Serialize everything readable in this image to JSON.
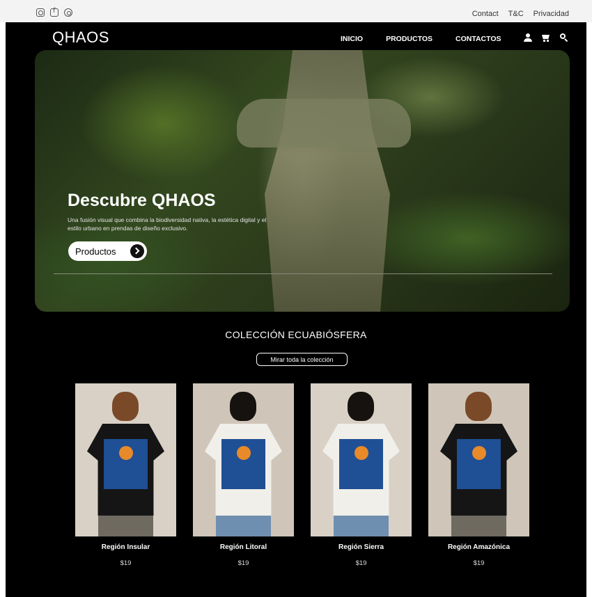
{
  "topbar": {
    "social_icons": [
      "instagram-icon",
      "facebook-icon",
      "whatsapp-icon"
    ],
    "links": [
      "Contact",
      "T&C",
      "Privacidad"
    ]
  },
  "header": {
    "logo": "QHAOS",
    "nav": [
      "INICIO",
      "PRODUCTOS",
      "CONTACTOS"
    ],
    "icons": [
      "user-icon",
      "cart-icon",
      "search-icon"
    ]
  },
  "hero": {
    "title": "Descubre QHAOS",
    "subtitle": "Una fusión visual que combina la biodiversidad nativa, la estética digital y el estilo urbano en prendas de diseño exclusivo.",
    "button_label": "Productos"
  },
  "collection": {
    "title": "COLECCIÓN ECUABIÓSFERA",
    "button_label": "Mirar toda la colección",
    "products": [
      {
        "name": "Región Insular",
        "price": "$19",
        "shirt_color": "#151515",
        "hair_color": "#7a4a28",
        "pants_color": "#6f6a60"
      },
      {
        "name": "Región Litoral",
        "price": "$19",
        "shirt_color": "#f1efe9",
        "hair_color": "#15120f",
        "pants_color": "#6f8fb0"
      },
      {
        "name": "Región Sierra",
        "price": "$19",
        "shirt_color": "#f1efe9",
        "hair_color": "#15120f",
        "pants_color": "#6f8fb0"
      },
      {
        "name": "Región Amazónica",
        "price": "$19",
        "shirt_color": "#151515",
        "hair_color": "#7a4a28",
        "pants_color": "#6f6a60"
      }
    ]
  },
  "colors": {
    "background": "#000000",
    "topbar": "#f3f3f3",
    "print_blue": "#1f4f95",
    "sun_orange": "#e88a2a"
  }
}
